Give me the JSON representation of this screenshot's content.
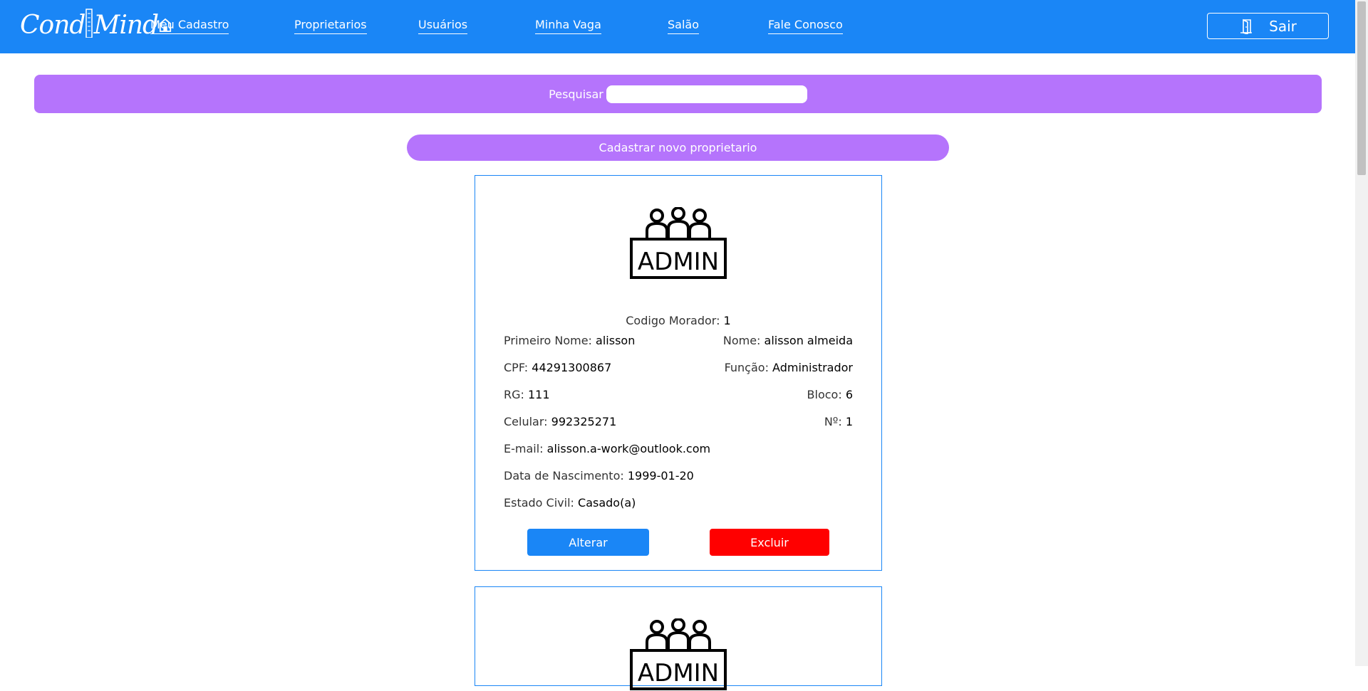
{
  "header": {
    "brand": "CondMind",
    "nav": [
      {
        "label": "Meu Cadastro"
      },
      {
        "label": "Proprietarios"
      },
      {
        "label": "Usuários"
      },
      {
        "label": "Minha Vaga"
      },
      {
        "label": "Salão"
      },
      {
        "label": "Fale Conosco"
      }
    ],
    "logout_label": "Sair",
    "logout_icon": "door-exit-icon"
  },
  "search": {
    "label": "Pesquisar",
    "value": "",
    "placeholder": ""
  },
  "new_owner_button": "Cadastrar novo proprietario",
  "cards": [
    {
      "icon": "admin-group-icon",
      "icon_text": "ADMIN",
      "codigo": {
        "label": "Codigo Morador:",
        "value": "1"
      },
      "primeiro_nome": {
        "label": "Primeiro Nome:",
        "value": "alisson"
      },
      "nome": {
        "label": "Nome:",
        "value": "alisson almeida"
      },
      "cpf": {
        "label": "CPF:",
        "value": "44291300867"
      },
      "funcao": {
        "label": "Função:",
        "value": "Administrador"
      },
      "rg": {
        "label": "RG:",
        "value": "111"
      },
      "bloco": {
        "label": "Bloco:",
        "value": "6"
      },
      "celular": {
        "label": "Celular:",
        "value": "992325271"
      },
      "numero": {
        "label": "Nº:",
        "value": "1"
      },
      "email": {
        "label": "E-mail:",
        "value": "alisson.a-work@outlook.com"
      },
      "nascimento": {
        "label": "Data de Nascimento:",
        "value": "1999-01-20"
      },
      "estado_civil": {
        "label": "Estado Civil:",
        "value": "Casado(a)"
      },
      "alterar_label": "Alterar",
      "excluir_label": "Excluir"
    },
    {
      "icon": "admin-group-icon",
      "icon_text": "ADMIN"
    }
  ],
  "colors": {
    "primary": "#1a86f6",
    "accent": "#b574fc",
    "danger": "#ff0000"
  }
}
